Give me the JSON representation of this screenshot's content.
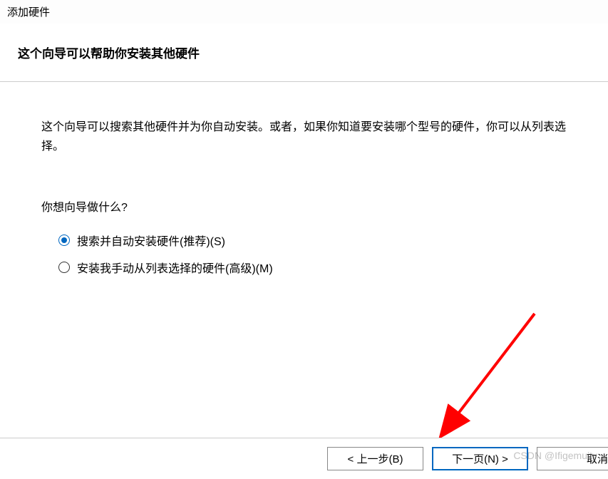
{
  "window": {
    "title": "添加硬件"
  },
  "header": {
    "title": "这个向导可以帮助你安装其他硬件"
  },
  "content": {
    "description": "这个向导可以搜索其他硬件并为你自动安装。或者，如果你知道要安装哪个型号的硬件，你可以从列表选择。",
    "question": "你想向导做什么?",
    "options": [
      {
        "label": "搜索并自动安装硬件(推荐)(S)",
        "selected": true
      },
      {
        "label": "安装我手动从列表选择的硬件(高级)(M)",
        "selected": false
      }
    ]
  },
  "buttons": {
    "back": "< 上一步(B)",
    "next": "下一页(N) >",
    "cancel": "取消"
  },
  "watermark": "CSDN @Ifigemuity"
}
